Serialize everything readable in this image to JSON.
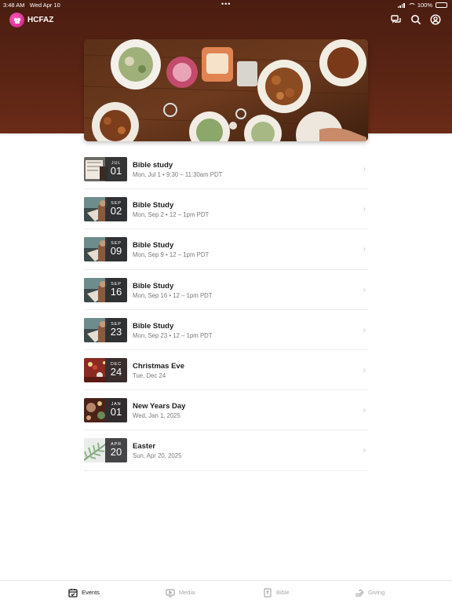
{
  "status_bar": {
    "time": "3:48 AM",
    "date": "Wed Apr 10",
    "battery": "100%",
    "dots": "•••"
  },
  "header": {
    "app_name": "HCFAZ",
    "icons": [
      "chat-icon",
      "search-icon",
      "account-icon"
    ]
  },
  "hero": {
    "image": "food-table-photo"
  },
  "events": [
    {
      "title": "Bible study",
      "subtitle": "Mon, Jul 1 • 9:30 – 11:30am PDT",
      "month": "JUL",
      "day": "01",
      "thumb": "bible-photo"
    },
    {
      "title": "Bible Study",
      "subtitle": "Mon, Sep 2 • 12 – 1pm PDT",
      "month": "SEP",
      "day": "02",
      "thumb": "reading-photo"
    },
    {
      "title": "Bible Study",
      "subtitle": "Mon, Sep 9 • 12 – 1pm PDT",
      "month": "SEP",
      "day": "09",
      "thumb": "reading-photo"
    },
    {
      "title": "Bible Study",
      "subtitle": "Mon, Sep 16 • 12 – 1pm PDT",
      "month": "SEP",
      "day": "16",
      "thumb": "reading-photo"
    },
    {
      "title": "Bible Study",
      "subtitle": "Mon, Sep 23 • 12 – 1pm PDT",
      "month": "SEP",
      "day": "23",
      "thumb": "reading-photo"
    },
    {
      "title": "Christmas Eve",
      "subtitle": "Tue, Dec 24",
      "month": "DEC",
      "day": "24",
      "thumb": "christmas-photo"
    },
    {
      "title": "New Years Day",
      "subtitle": "Wed, Jan 1, 2025",
      "month": "JAN",
      "day": "01",
      "thumb": "newyear-photo"
    },
    {
      "title": "Easter",
      "subtitle": "Sun, Apr 20, 2025",
      "month": "APR",
      "day": "20",
      "thumb": "palm-photo"
    }
  ],
  "tabs": [
    {
      "label": "Events",
      "icon": "calendar-icon",
      "active": true
    },
    {
      "label": "Media",
      "icon": "media-icon",
      "active": false
    },
    {
      "label": "Bible",
      "icon": "bible-icon",
      "active": false
    },
    {
      "label": "Giving",
      "icon": "giving-icon",
      "active": false
    }
  ],
  "colors": {
    "header_bg": "#5a2414",
    "accent_avatar": "#e0309a",
    "date_badge": "#2d2d30",
    "tab_active": "#1a1a1a",
    "tab_inactive": "#a8a8a8"
  }
}
